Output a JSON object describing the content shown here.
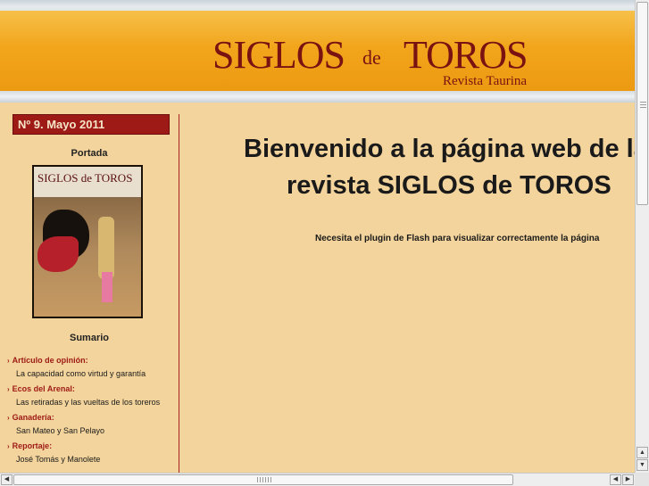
{
  "header": {
    "logo_siglos": "SIGLOS",
    "logo_de": "de",
    "logo_toros": "TOROS",
    "logo_subtitle": "Revista Taurina"
  },
  "sidebar": {
    "issue": "Nº 9. Mayo 2011",
    "portada_heading": "Portada",
    "cover": {
      "title": "SIGLOS de TOROS"
    },
    "sumario_heading": "Sumario",
    "items": [
      {
        "category": "Artículo de opinión:",
        "article": "La capacidad como virtud y garantía"
      },
      {
        "category": "Ecos del Arenal:",
        "article": "Las retiradas y las vueltas de los toreros"
      },
      {
        "category": "Ganadería:",
        "article": "San Mateo y San Pelayo"
      },
      {
        "category": "Reportaje:",
        "article": "José Tomás y Manolete"
      }
    ]
  },
  "main": {
    "welcome_line1": "Bienvenido a la página web de la",
    "welcome_line2": "revista SIGLOS de TOROS",
    "flash_note": "Necesita el plugin de Flash para visualizar correctamente la página"
  },
  "icons": {
    "arrow": "›",
    "up": "▲",
    "down": "▼",
    "left": "◀",
    "right": "▶"
  },
  "colors": {
    "background": "#f3d49c",
    "accent": "#9e1a16",
    "header": "#f2a51b"
  }
}
